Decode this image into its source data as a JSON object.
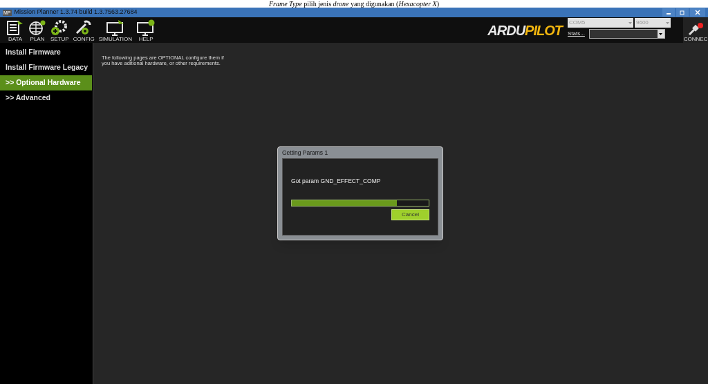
{
  "document_caption": "*Frame Type* pilih jenis *drone* yang digunakan (*Hexacopter X*)",
  "window": {
    "title": "Mission Planner 1.3.74 build 1.3.7563.27684",
    "app_icon": "MP"
  },
  "toolbar": [
    {
      "label": "DATA",
      "kind": "data"
    },
    {
      "label": "PLAN",
      "kind": "plan"
    },
    {
      "label": "SETUP",
      "kind": "setup"
    },
    {
      "label": "CONFIG",
      "kind": "config"
    },
    {
      "label": "SIMULATION",
      "kind": "simulation"
    },
    {
      "label": "HELP",
      "kind": "help"
    }
  ],
  "logo": {
    "left": "ARDU",
    "right": "PILOT"
  },
  "connection": {
    "port": "COM5",
    "baud": "9600",
    "stats_link": "Stats...",
    "connect_label": "CONNEC"
  },
  "sidebar": {
    "items": [
      {
        "label": "Install Firmware",
        "selected": false
      },
      {
        "label": "Install Firmware Legacy",
        "selected": false
      },
      {
        "label": ">> Optional Hardware",
        "selected": true
      },
      {
        "label": ">> Advanced",
        "selected": false
      }
    ]
  },
  "content": {
    "text": "The following pages are OPTIONAL configure them if you have aditional hardware, or other requirements."
  },
  "dialog": {
    "title": "Getting Params 1",
    "message": "Got param GND_EFFECT_COMP",
    "progress": {
      "level": 0.77
    },
    "button": "Cancel"
  }
}
